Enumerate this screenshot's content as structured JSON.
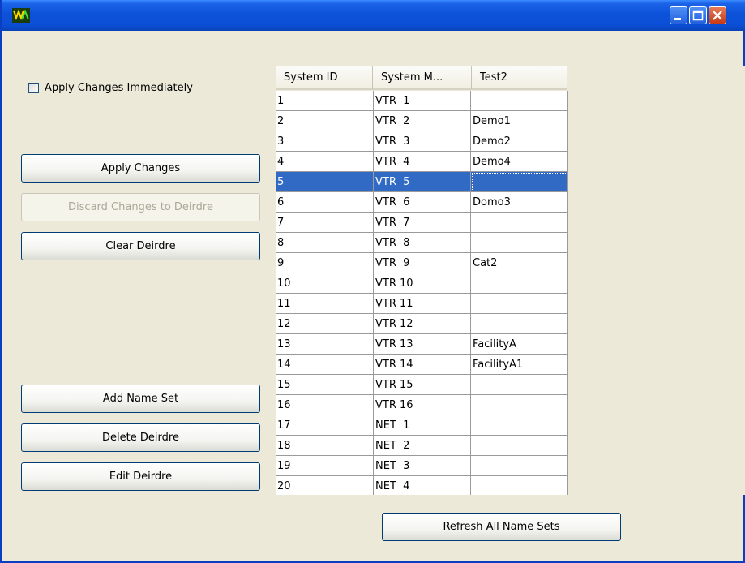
{
  "window": {
    "title": "",
    "app_icon": "app-icon",
    "controls": [
      "minimize-icon",
      "maximize-icon",
      "close-icon"
    ]
  },
  "left_panel": {
    "apply_immediately": {
      "label": "Apply Changes Immediately",
      "checked": false
    },
    "buttons": {
      "apply_changes": "Apply Changes",
      "discard_changes": "Discard Changes to Deirdre",
      "clear": "Clear Deirdre",
      "add_name_set": "Add Name Set",
      "delete": "Delete Deirdre",
      "edit": "Edit Deirdre"
    }
  },
  "table": {
    "columns": [
      "System ID",
      "System M...",
      "Test2"
    ],
    "selected_row": 5,
    "rows": [
      [
        "1",
        "VTR  1",
        ""
      ],
      [
        "2",
        "VTR  2",
        "Demo1"
      ],
      [
        "3",
        "VTR  3",
        "Demo2"
      ],
      [
        "4",
        "VTR  4",
        "Demo4"
      ],
      [
        "5",
        "VTR  5",
        ""
      ],
      [
        "6",
        "VTR  6",
        "Domo3"
      ],
      [
        "7",
        "VTR  7",
        ""
      ],
      [
        "8",
        "VTR  8",
        ""
      ],
      [
        "9",
        "VTR  9",
        "Cat2"
      ],
      [
        "10",
        "VTR 10",
        ""
      ],
      [
        "11",
        "VTR 11",
        ""
      ],
      [
        "12",
        "VTR 12",
        ""
      ],
      [
        "13",
        "VTR 13",
        "FacilityA"
      ],
      [
        "14",
        "VTR 14",
        "FacilityA1"
      ],
      [
        "15",
        "VTR 15",
        ""
      ],
      [
        "16",
        "VTR 16",
        ""
      ],
      [
        "17",
        "NET  1",
        ""
      ],
      [
        "18",
        "NET  2",
        ""
      ],
      [
        "19",
        "NET  3",
        ""
      ],
      [
        "20",
        "NET  4",
        ""
      ]
    ]
  },
  "refresh_button": "Refresh All Name Sets",
  "colors": {
    "selection": "#316ac5",
    "titlebar": "#0b4fd6",
    "window_bg": "#ece9d8"
  }
}
